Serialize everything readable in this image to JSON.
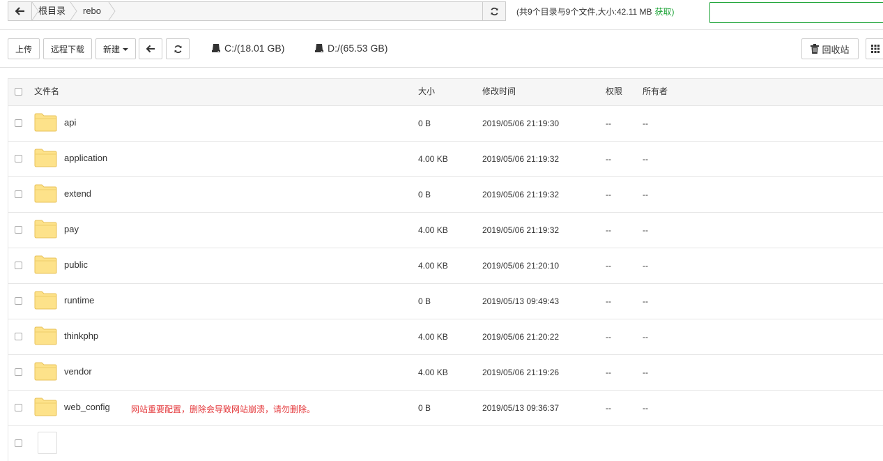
{
  "path": {
    "crumbs": [
      "根目录",
      "rebo"
    ]
  },
  "summary": {
    "text": "(共9个目录与9个文件,大小:42.11 MB",
    "get_label": "获取)"
  },
  "toolbar": {
    "upload": "上传",
    "remote_download": "远程下载",
    "new": "新建",
    "recycle": "回收站"
  },
  "disks": [
    {
      "label": "C:/(18.01 GB)"
    },
    {
      "label": "D:/(65.53 GB)"
    }
  ],
  "table": {
    "headers": {
      "name": "文件名",
      "size": "大小",
      "mtime": "修改时间",
      "perm": "权限",
      "owner": "所有者"
    },
    "rows": [
      {
        "name": "api",
        "size": "0 B",
        "mtime": "2019/05/06 21:19:30",
        "perm": "--",
        "owner": "--"
      },
      {
        "name": "application",
        "size": "4.00 KB",
        "mtime": "2019/05/06 21:19:32",
        "perm": "--",
        "owner": "--"
      },
      {
        "name": "extend",
        "size": "0 B",
        "mtime": "2019/05/06 21:19:32",
        "perm": "--",
        "owner": "--"
      },
      {
        "name": "pay",
        "size": "4.00 KB",
        "mtime": "2019/05/06 21:19:32",
        "perm": "--",
        "owner": "--"
      },
      {
        "name": "public",
        "size": "4.00 KB",
        "mtime": "2019/05/06 21:20:10",
        "perm": "--",
        "owner": "--"
      },
      {
        "name": "runtime",
        "size": "0 B",
        "mtime": "2019/05/13 09:49:43",
        "perm": "--",
        "owner": "--"
      },
      {
        "name": "thinkphp",
        "size": "4.00 KB",
        "mtime": "2019/05/06 21:20:22",
        "perm": "--",
        "owner": "--"
      },
      {
        "name": "vendor",
        "size": "4.00 KB",
        "mtime": "2019/05/06 21:19:26",
        "perm": "--",
        "owner": "--"
      },
      {
        "name": "web_config",
        "size": "0 B",
        "mtime": "2019/05/13 09:36:37",
        "perm": "--",
        "owner": "--",
        "note": "网站重要配置，删除会导致网站崩溃，请勿删除。"
      }
    ]
  },
  "colors": {
    "accent": "#20a53a",
    "warning": "#e4393c",
    "folder": "#fde28a"
  }
}
